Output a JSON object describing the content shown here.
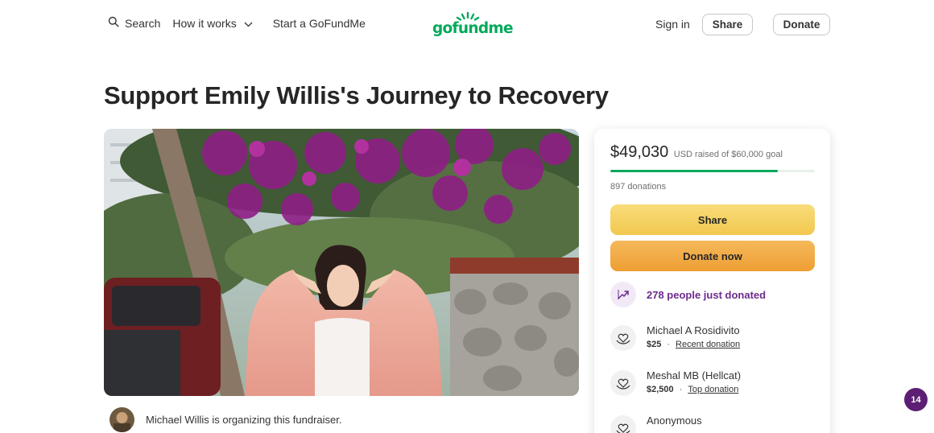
{
  "header": {
    "search_label": "Search",
    "how_it_works_label": "How it works",
    "start_label": "Start a GoFundMe",
    "logo_text": "gofundme",
    "sign_in_label": "Sign in",
    "share_label": "Share",
    "donate_label": "Donate"
  },
  "campaign": {
    "title": "Support Emily Willis's Journey to Recovery",
    "organizer_text": "Michael Willis is organizing this fundraiser."
  },
  "donation_card": {
    "raised_amount": "$49,030",
    "goal_text": "USD raised of $60,000 goal",
    "progress_fraction": 0.817,
    "donations_count_text": "897 donations",
    "share_label": "Share",
    "donate_now_label": "Donate now",
    "trending_text": "278 people just donated",
    "donors": [
      {
        "name": "Michael A Rosidivito",
        "amount": "$25",
        "tag": "Recent donation"
      },
      {
        "name": "Meshal MB (Hellcat)",
        "amount": "$2,500",
        "tag": "Top donation"
      },
      {
        "name": "Anonymous",
        "amount": "",
        "tag": ""
      }
    ]
  },
  "chat_badge": {
    "count": "14"
  },
  "colors": {
    "brand_green": "#02a95c",
    "share_yellow": "#f2c84f",
    "donate_orange": "#ee9f33",
    "trending_purple": "#6b2b8c",
    "chat_badge_purple": "#5c1f74"
  },
  "icons": [
    "search-icon",
    "chevron-down-icon",
    "trending-up-icon",
    "donor-heart-icon",
    "organizer-avatar"
  ]
}
